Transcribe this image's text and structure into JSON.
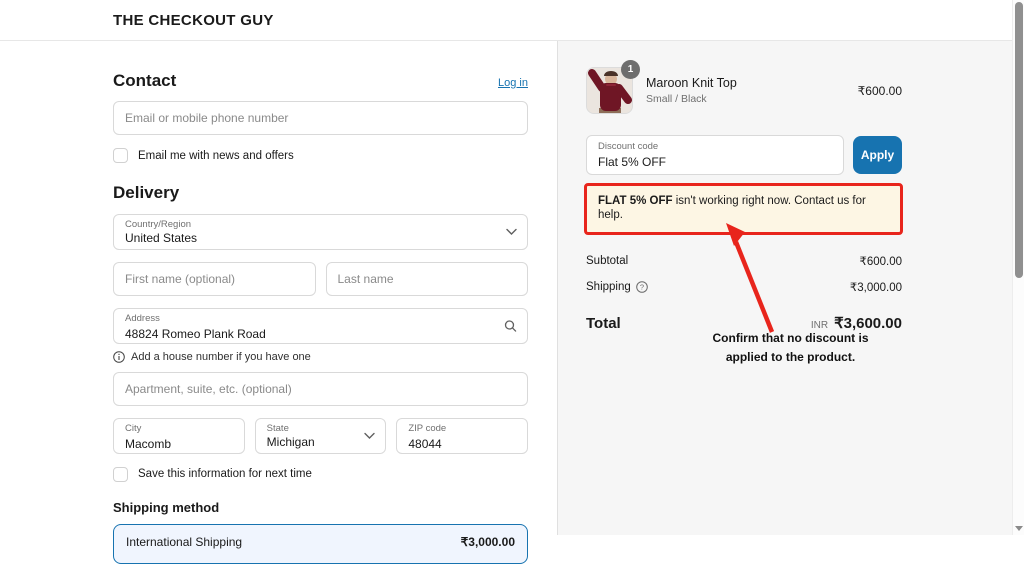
{
  "header": {
    "store_name": "THE CHECKOUT GUY"
  },
  "contact": {
    "title": "Contact",
    "login_label": "Log in",
    "email_placeholder": "Email or mobile phone number",
    "news_offers_label": "Email me with news and offers"
  },
  "delivery": {
    "title": "Delivery",
    "country": {
      "label": "Country/Region",
      "value": "United States"
    },
    "first_name_placeholder": "First name (optional)",
    "last_name_placeholder": "Last name",
    "address": {
      "label": "Address",
      "value": "48824 Romeo Plank Road"
    },
    "address_hint": "Add a house number if you have one",
    "apartment_placeholder": "Apartment, suite, etc. (optional)",
    "city": {
      "label": "City",
      "value": "Macomb"
    },
    "state": {
      "label": "State",
      "value": "Michigan"
    },
    "zip": {
      "label": "ZIP code",
      "value": "48044"
    },
    "save_info_label": "Save this information for next time"
  },
  "shipping_method": {
    "title": "Shipping method",
    "options": [
      {
        "name": "International Shipping",
        "price": "₹3,000.00"
      }
    ]
  },
  "order_summary": {
    "item": {
      "name": "Maroon Knit Top",
      "variant": "Small / Black",
      "quantity": "1",
      "price": "₹600.00"
    },
    "discount": {
      "label": "Discount code",
      "value": "Flat 5% OFF",
      "apply_label": "Apply"
    },
    "error": {
      "code": "FLAT 5% OFF",
      "message": " isn't working right now. Contact us for help."
    },
    "subtotal_label": "Subtotal",
    "subtotal_value": "₹600.00",
    "shipping_label": "Shipping",
    "shipping_value": "₹3,000.00",
    "total_label": "Total",
    "currency_code": "INR",
    "total_value": "₹3,600.00"
  },
  "annotation": {
    "line1": "Confirm that no discount is",
    "line2": "applied to the product."
  },
  "colors": {
    "accent_blue": "#1773b0",
    "annotation_red": "#e8251c",
    "error_banner_bg": "#fdf6e4"
  }
}
